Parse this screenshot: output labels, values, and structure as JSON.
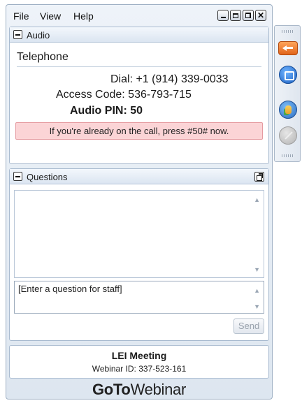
{
  "menu": {
    "file": "File",
    "view": "View",
    "help": "Help"
  },
  "window_controls": [
    "minimize-icon",
    "maximize-icon",
    "restore-icon",
    "close-icon"
  ],
  "audio": {
    "title": "Audio",
    "mode": "Telephone",
    "dial_label": "Dial:",
    "dial_number": "+1 (914) 339-0033",
    "access_code_label": "Access Code:",
    "access_code": "536-793-715",
    "pin_label": "Audio PIN:",
    "pin": "50",
    "notice": "If you're already on the call, press #50# now.",
    "notice_color": "#fbd4d6"
  },
  "questions": {
    "title": "Questions",
    "input_placeholder": "[Enter a question for staff]",
    "send_label": "Send"
  },
  "meeting": {
    "name": "LEI Meeting",
    "webinar_id_label": "Webinar ID:",
    "webinar_id": "337-523-161"
  },
  "brand": {
    "part1": "GoTo",
    "part2": "Webinar"
  },
  "sidebar": {
    "buttons": [
      "arrow-left-icon",
      "screen-share-icon",
      "raise-hand-icon",
      "disabled-icon"
    ],
    "accent": "#e0641a"
  }
}
